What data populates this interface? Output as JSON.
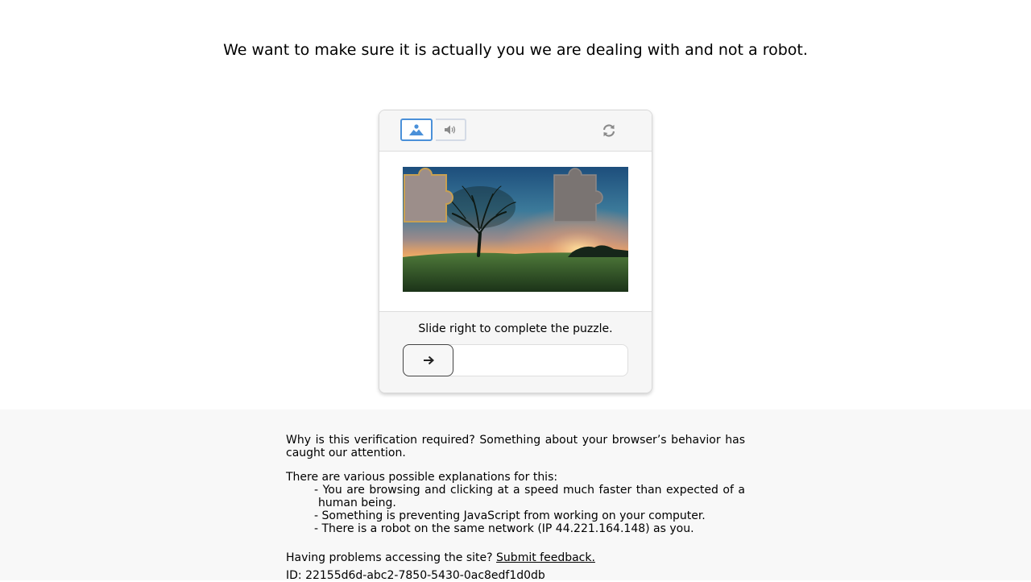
{
  "headline": "We want to make sure it is actually you we are dealing with and not a robot.",
  "captcha": {
    "modes": [
      {
        "name": "image",
        "icon": "image-icon",
        "selected": true
      },
      {
        "name": "audio",
        "icon": "speaker-icon",
        "selected": false
      }
    ],
    "refresh_icon": "refresh-icon",
    "instruction": "Slide right to complete the puzzle.",
    "slider_icon": "arrow-right-icon",
    "slider_progress": 0
  },
  "info": {
    "why": "Why is this verification required? Something about your browser’s behavior has caught our attention.",
    "explanations_intro": "There are various possible explanations for this:",
    "explanations": [
      "- You are browsing and clicking at a speed much faster than expected of a human being.",
      "- Something is preventing JavaScript from working on your computer.",
      "- There is a robot on the same network (IP 44.221.164.148) as you."
    ],
    "problems_text": "Having problems accessing the site?",
    "feedback_link": "Submit feedback.",
    "id_text": "ID: 22155d6d-abc2-7850-5430-0ac8edf1d0db"
  },
  "colors": {
    "accent": "#4a90d9",
    "piece_outline": "#c8a052",
    "panel_bg": "#f6f6f6",
    "bottom_bg": "#f8f8f8"
  }
}
